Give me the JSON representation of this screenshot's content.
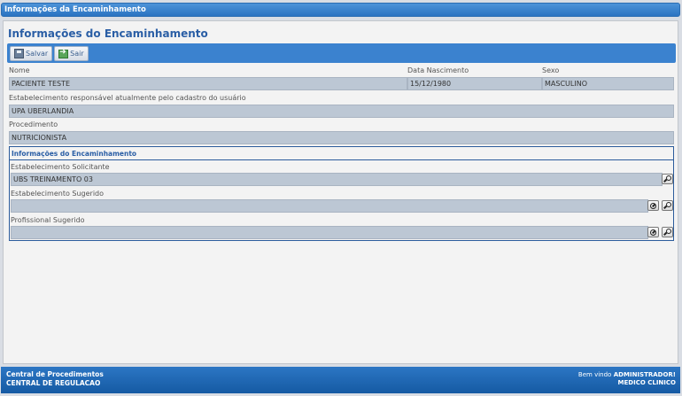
{
  "window": {
    "title": "Informações da Encaminhamento"
  },
  "page": {
    "title": "Informações do Encaminhamento"
  },
  "toolbar": {
    "save_label": "Salvar",
    "exit_label": "Sair"
  },
  "patient": {
    "name_label": "Nome",
    "name_value": "PACIENTE TESTE",
    "birth_label": "Data Nascimento",
    "birth_value": "15/12/1980",
    "sex_label": "Sexo",
    "sex_value": "MASCULINO"
  },
  "establishment": {
    "label": "Estabelecimento responsável atualmente pelo cadastro do usuário",
    "value": "UPA UBERLANDIA"
  },
  "procedure": {
    "label": "Procedimento",
    "value": "NUTRICIONISTA"
  },
  "referral": {
    "section_title": "Informações do Encaminhamento",
    "requesting_label": "Estabelecimento Solicitante",
    "requesting_value": "UBS TREINAMENTO 03",
    "suggested_label": "Estabelecimento Sugerido",
    "suggested_value": "",
    "professional_label": "Profissional Sugerido",
    "professional_value": ""
  },
  "footer": {
    "line1": "Central de Procedimentos",
    "line2": "CENTRAL DE REGULACAO",
    "welcome_prefix": "Bem vindo",
    "user": "ADMINISTRADOR!",
    "role": "MEDICO CLINICO"
  },
  "icons": {
    "save": "save-icon",
    "exit": "exit-icon",
    "clear": "clear-icon",
    "search": "search-icon"
  }
}
